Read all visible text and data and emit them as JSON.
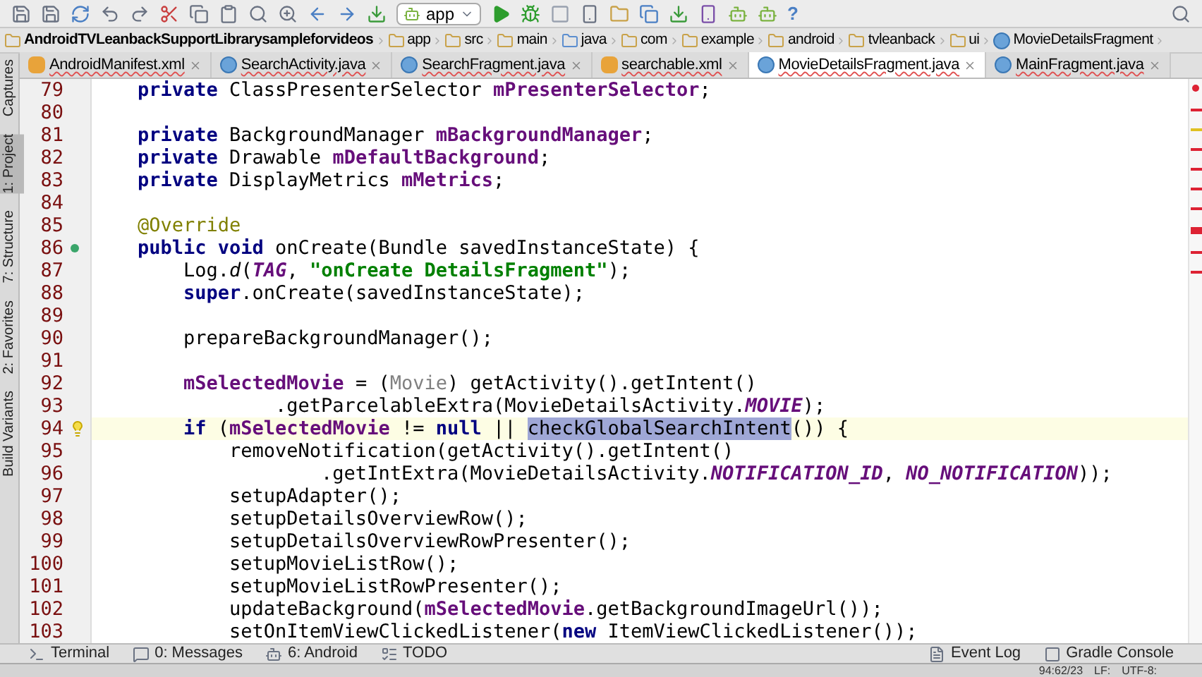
{
  "toolbar": {
    "run_config": "app",
    "help": "?"
  },
  "breadcrumbs": [
    {
      "label": "AndroidTVLeanbackSupportLibrarysampleforvideos",
      "kind": "project"
    },
    {
      "label": "app",
      "kind": "folder"
    },
    {
      "label": "src",
      "kind": "folder"
    },
    {
      "label": "main",
      "kind": "folder"
    },
    {
      "label": "java",
      "kind": "source"
    },
    {
      "label": "com",
      "kind": "folder"
    },
    {
      "label": "example",
      "kind": "folder"
    },
    {
      "label": "android",
      "kind": "folder"
    },
    {
      "label": "tvleanback",
      "kind": "folder"
    },
    {
      "label": "ui",
      "kind": "folder"
    },
    {
      "label": "MovieDetailsFragment",
      "kind": "class"
    }
  ],
  "side_tools": [
    {
      "label": "Captures",
      "selected": false
    },
    {
      "label": "1: Project",
      "selected": true
    },
    {
      "label": "7: Structure",
      "selected": false
    },
    {
      "label": "2: Favorites",
      "selected": false
    },
    {
      "label": "Build Variants",
      "selected": false
    }
  ],
  "tabs": [
    {
      "label": "AndroidManifest.xml",
      "kind": "xml",
      "selected": false
    },
    {
      "label": "SearchActivity.java",
      "kind": "class",
      "selected": false
    },
    {
      "label": "SearchFragment.java",
      "kind": "class",
      "selected": false
    },
    {
      "label": "searchable.xml",
      "kind": "xml",
      "selected": false
    },
    {
      "label": "MovieDetailsFragment.java",
      "kind": "class",
      "selected": true
    },
    {
      "label": "MainFragment.java",
      "kind": "class",
      "selected": false
    }
  ],
  "editor": {
    "lines": [
      {
        "number": "79",
        "current": false,
        "override_marker": false,
        "bulb": false,
        "tokens": [
          {
            "kind": "keyword",
            "text": "    private"
          },
          {
            "kind": "plain",
            "text": " ClassPresenterSelector "
          },
          {
            "kind": "field",
            "text": "mPresenterSelector"
          },
          {
            "kind": "plain",
            "text": ";"
          }
        ]
      },
      {
        "number": "80",
        "current": false,
        "override_marker": false,
        "bulb": false
      },
      {
        "number": "81",
        "current": false,
        "override_marker": false,
        "bulb": false,
        "tokens": [
          {
            "kind": "keyword",
            "text": "    private"
          },
          {
            "kind": "plain",
            "text": " BackgroundManager "
          },
          {
            "kind": "field",
            "text": "mBackgroundManager"
          },
          {
            "kind": "plain",
            "text": ";"
          }
        ]
      },
      {
        "number": "82",
        "current": false,
        "override_marker": false,
        "bulb": false,
        "tokens": [
          {
            "kind": "keyword",
            "text": "    private"
          },
          {
            "kind": "plain",
            "text": " Drawable "
          },
          {
            "kind": "field",
            "text": "mDefaultBackground"
          },
          {
            "kind": "plain",
            "text": ";"
          }
        ]
      },
      {
        "number": "83",
        "current": false,
        "override_marker": false,
        "bulb": false,
        "tokens": [
          {
            "kind": "keyword",
            "text": "    private"
          },
          {
            "kind": "plain",
            "text": " DisplayMetrics "
          },
          {
            "kind": "field",
            "text": "mMetrics"
          },
          {
            "kind": "plain",
            "text": ";"
          }
        ]
      },
      {
        "number": "84",
        "current": false,
        "override_marker": false,
        "bulb": false
      },
      {
        "number": "85",
        "current": false,
        "override_marker": false,
        "bulb": false,
        "tokens": [
          {
            "kind": "annotation",
            "text": "    @Override"
          }
        ]
      },
      {
        "number": "86",
        "current": false,
        "override_marker": true,
        "bulb": false,
        "tokens": [
          {
            "kind": "keyword",
            "text": "    public void"
          },
          {
            "kind": "plain",
            "text": " onCreate(Bundle savedInstanceState) {"
          }
        ]
      },
      {
        "number": "87",
        "current": false,
        "override_marker": false,
        "bulb": false,
        "tokens": [
          {
            "kind": "plain",
            "text": "        Log."
          },
          {
            "kind": "italic",
            "text": "d"
          },
          {
            "kind": "plain",
            "text": "("
          },
          {
            "kind": "constant",
            "text": "TAG"
          },
          {
            "kind": "plain",
            "text": ", "
          },
          {
            "kind": "string",
            "text": "\"onCreate DetailsFragment\""
          },
          {
            "kind": "plain",
            "text": ");"
          }
        ]
      },
      {
        "number": "88",
        "current": false,
        "override_marker": false,
        "bulb": false,
        "tokens": [
          {
            "kind": "keyword",
            "text": "        super"
          },
          {
            "kind": "plain",
            "text": ".onCreate(savedInstanceState);"
          }
        ]
      },
      {
        "number": "89",
        "current": false,
        "override_marker": false,
        "bulb": false
      },
      {
        "number": "90",
        "current": false,
        "override_marker": false,
        "bulb": false,
        "tokens": [
          {
            "kind": "plain",
            "text": "        prepareBackgroundManager();"
          }
        ]
      },
      {
        "number": "91",
        "current": false,
        "override_marker": false,
        "bulb": false
      },
      {
        "number": "92",
        "current": false,
        "override_marker": false,
        "bulb": false,
        "tokens": [
          {
            "kind": "field",
            "text": "        mSelectedMovie"
          },
          {
            "kind": "plain",
            "text": " = ("
          },
          {
            "kind": "unused",
            "text": "Movie"
          },
          {
            "kind": "plain",
            "text": ") getActivity().getIntent()"
          }
        ]
      },
      {
        "number": "93",
        "current": false,
        "override_marker": false,
        "bulb": false,
        "tokens": [
          {
            "kind": "plain",
            "text": "                .getParcelableExtra(MovieDetailsActivity."
          },
          {
            "kind": "constant",
            "text": "MOVIE"
          },
          {
            "kind": "plain",
            "text": ");"
          }
        ]
      },
      {
        "number": "94",
        "current": true,
        "override_marker": false,
        "bulb": true,
        "tokens": [
          {
            "kind": "keyword",
            "text": "        if"
          },
          {
            "kind": "plain",
            "text": " ("
          },
          {
            "kind": "field",
            "text": "mSelectedMovie"
          },
          {
            "kind": "plain",
            "text": " != "
          },
          {
            "kind": "keyword",
            "text": "null"
          },
          {
            "kind": "plain",
            "text": " || "
          },
          {
            "kind": "selection",
            "text": "checkGlobalSearchIntent"
          },
          {
            "kind": "plain",
            "text": "()) {"
          }
        ]
      },
      {
        "number": "95",
        "current": false,
        "override_marker": false,
        "bulb": false,
        "tokens": [
          {
            "kind": "plain",
            "text": "            removeNotification(getActivity().getIntent()"
          }
        ]
      },
      {
        "number": "96",
        "current": false,
        "override_marker": false,
        "bulb": false,
        "tokens": [
          {
            "kind": "plain",
            "text": "                    .getIntExtra(MovieDetailsActivity."
          },
          {
            "kind": "constant",
            "text": "NOTIFICATION_ID"
          },
          {
            "kind": "plain",
            "text": ", "
          },
          {
            "kind": "constant",
            "text": "NO_NOTIFICATION"
          },
          {
            "kind": "plain",
            "text": "));"
          }
        ]
      },
      {
        "number": "97",
        "current": false,
        "override_marker": false,
        "bulb": false,
        "tokens": [
          {
            "kind": "plain",
            "text": "            setupAdapter();"
          }
        ]
      },
      {
        "number": "98",
        "current": false,
        "override_marker": false,
        "bulb": false,
        "tokens": [
          {
            "kind": "plain",
            "text": "            setupDetailsOverviewRow();"
          }
        ]
      },
      {
        "number": "99",
        "current": false,
        "override_marker": false,
        "bulb": false,
        "tokens": [
          {
            "kind": "plain",
            "text": "            setupDetailsOverviewRowPresenter();"
          }
        ]
      },
      {
        "number": "100",
        "current": false,
        "override_marker": false,
        "bulb": false,
        "tokens": [
          {
            "kind": "plain",
            "text": "            setupMovieListRow();"
          }
        ]
      },
      {
        "number": "101",
        "current": false,
        "override_marker": false,
        "bulb": false,
        "tokens": [
          {
            "kind": "plain",
            "text": "            setupMovieListRowPresenter();"
          }
        ]
      },
      {
        "number": "102",
        "current": false,
        "override_marker": false,
        "bulb": false,
        "tokens": [
          {
            "kind": "plain",
            "text": "            updateBackground("
          },
          {
            "kind": "field",
            "text": "mSelectedMovie"
          },
          {
            "kind": "plain",
            "text": ".getBackgroundImageUrl());"
          }
        ]
      },
      {
        "number": "103",
        "current": false,
        "override_marker": false,
        "bulb": false,
        "tokens": [
          {
            "kind": "plain",
            "text": "            setOnItemViewClickedListener("
          },
          {
            "kind": "keyword",
            "text": "new"
          },
          {
            "kind": "plain",
            "text": " ItemViewClickedListener());"
          }
        ]
      }
    ]
  },
  "tool_windows_left": [
    {
      "label": "Terminal",
      "kind": "terminal"
    },
    {
      "label": "0: Messages",
      "kind": "messages"
    },
    {
      "label": "6: Android",
      "kind": "android"
    },
    {
      "label": "TODO",
      "kind": "todo"
    }
  ],
  "tool_windows_right": [
    {
      "label": "Event Log",
      "kind": "log"
    },
    {
      "label": "Gradle Console",
      "kind": "console"
    }
  ],
  "status_bar": {
    "position": "94:62/23",
    "line_separator": "LF:",
    "encoding": "UTF-8:"
  }
}
